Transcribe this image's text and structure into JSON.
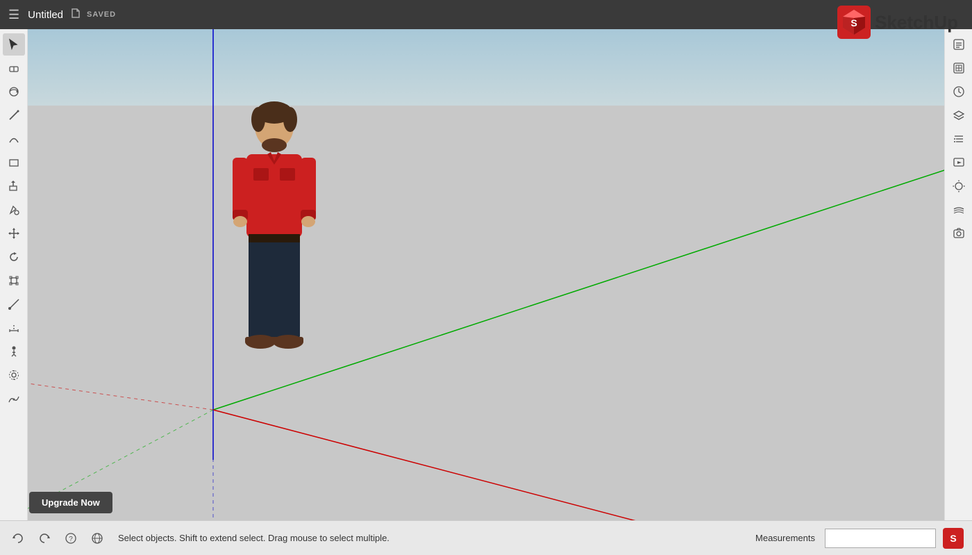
{
  "topbar": {
    "title": "Untitled",
    "saved_label": "SAVED"
  },
  "logo": {
    "text": "SketchUp"
  },
  "statusbar": {
    "status_text": "Select objects. Shift to extend select. Drag mouse to select multiple.",
    "measurements_label": "Measurements"
  },
  "upgrade": {
    "label": "Upgrade Now"
  },
  "tools": {
    "left": [
      {
        "name": "select",
        "icon": "cursor"
      },
      {
        "name": "eraser",
        "icon": "eraser"
      },
      {
        "name": "orbit",
        "icon": "orbit"
      },
      {
        "name": "line",
        "icon": "line"
      },
      {
        "name": "arc",
        "icon": "arc"
      },
      {
        "name": "shape",
        "icon": "shape"
      },
      {
        "name": "push-pull",
        "icon": "push-pull"
      },
      {
        "name": "paint",
        "icon": "paint"
      },
      {
        "name": "move",
        "icon": "move"
      },
      {
        "name": "rotate",
        "icon": "rotate"
      },
      {
        "name": "offset",
        "icon": "offset"
      },
      {
        "name": "tape",
        "icon": "tape"
      },
      {
        "name": "dimensions",
        "icon": "dimensions"
      },
      {
        "name": "text",
        "icon": "text"
      },
      {
        "name": "axes",
        "icon": "axes"
      },
      {
        "name": "walk",
        "icon": "walk"
      }
    ],
    "right": [
      {
        "name": "entity-info",
        "icon": "entity-info"
      },
      {
        "name": "components",
        "icon": "components"
      },
      {
        "name": "styles",
        "icon": "styles"
      },
      {
        "name": "layers",
        "icon": "layers"
      },
      {
        "name": "outliner",
        "icon": "outliner"
      },
      {
        "name": "scenes",
        "icon": "scenes"
      },
      {
        "name": "shadows",
        "icon": "shadows"
      },
      {
        "name": "fog",
        "icon": "fog"
      },
      {
        "name": "match-photo",
        "icon": "match-photo"
      }
    ]
  }
}
